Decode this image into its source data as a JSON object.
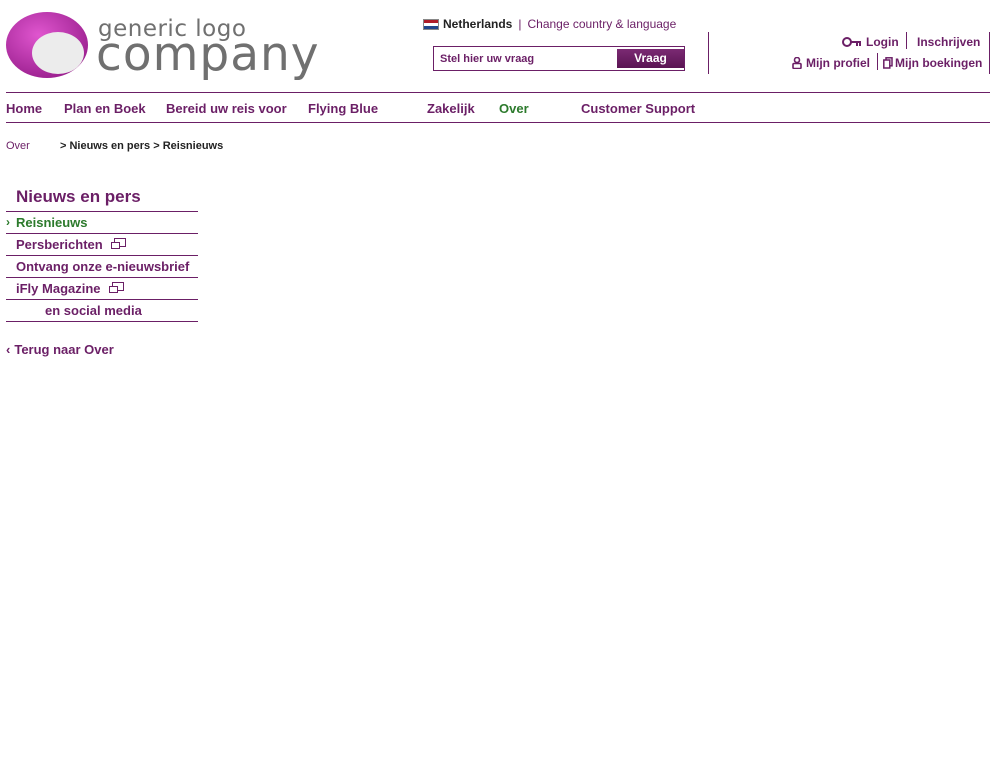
{
  "logo": {
    "line1": "generic logo",
    "line2": "company"
  },
  "colors": {
    "brand": "#6b1f66",
    "accent_logo": "#c02ab0",
    "active": "#2c7a2c"
  },
  "header": {
    "country": "Netherlands",
    "separator": "|",
    "change_country": "Change country & language",
    "search_placeholder": "Stel hier uw vraag",
    "search_button": "Vraag",
    "login": "Login",
    "register": "Inschrijven",
    "profile": "Mijn profiel",
    "bookings": "Mijn boekingen"
  },
  "mainnav": {
    "items": [
      {
        "label": "Home"
      },
      {
        "label": "Plan en Boek"
      },
      {
        "label": "Bereid uw reis voor"
      },
      {
        "label": "Flying Blue"
      },
      {
        "label": "Zakelijk"
      },
      {
        "label": "Over",
        "active": true
      },
      {
        "label": "Customer Support"
      }
    ]
  },
  "breadcrumb": {
    "root": "Over",
    "middle": "> Nieuws en pers",
    "current": "> Reisnieuws"
  },
  "sidebar": {
    "title": "Nieuws en pers",
    "active_marker": "›",
    "items": [
      {
        "label": "Reisnieuws",
        "active": true
      },
      {
        "label": "Persberichten",
        "icon": "external-window-icon"
      },
      {
        "label": "Ontvang onze e-nieuwsbrief"
      },
      {
        "label": "iFly Magazine",
        "icon": "external-window-icon"
      },
      {
        "label": "en social media"
      }
    ],
    "back_chevron": "‹",
    "back": "Terug naar Over"
  }
}
